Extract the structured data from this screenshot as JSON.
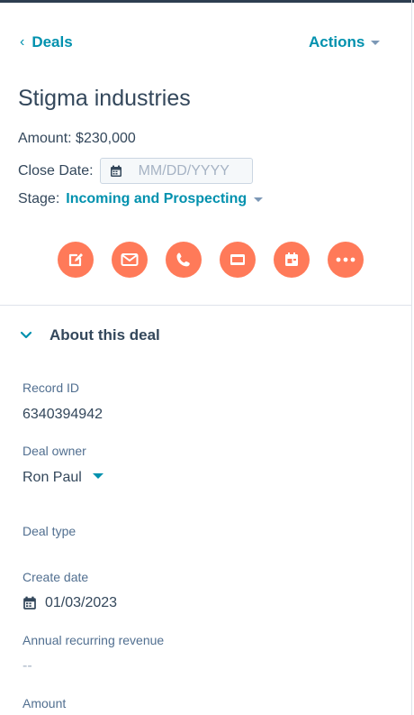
{
  "nav": {
    "back_label": "Deals",
    "actions_label": "Actions"
  },
  "deal": {
    "name": "Stigma industries",
    "amount_label": "Amount:",
    "amount_value": "$230,000",
    "close_date_label": "Close Date:",
    "close_date_placeholder": "MM/DD/YYYY",
    "stage_label": "Stage:",
    "stage_value": "Incoming and Prospecting"
  },
  "action_buttons": [
    {
      "icon": "note-icon"
    },
    {
      "icon": "email-icon"
    },
    {
      "icon": "call-icon"
    },
    {
      "icon": "log-activity-icon"
    },
    {
      "icon": "task-icon"
    },
    {
      "icon": "more-icon"
    }
  ],
  "about": {
    "heading": "About this deal",
    "record_id_label": "Record ID",
    "record_id_value": "6340394942",
    "deal_owner_label": "Deal owner",
    "deal_owner_value": "Ron Paul",
    "deal_type_label": "Deal type",
    "create_date_label": "Create date",
    "create_date_value": "01/03/2023",
    "arr_label": "Annual recurring revenue",
    "arr_value": "--",
    "amount_label": "Amount"
  },
  "colors": {
    "accent": "#0091ae",
    "action_orange": "#ff7a59",
    "text": "#33475b",
    "muted": "#516f90"
  }
}
